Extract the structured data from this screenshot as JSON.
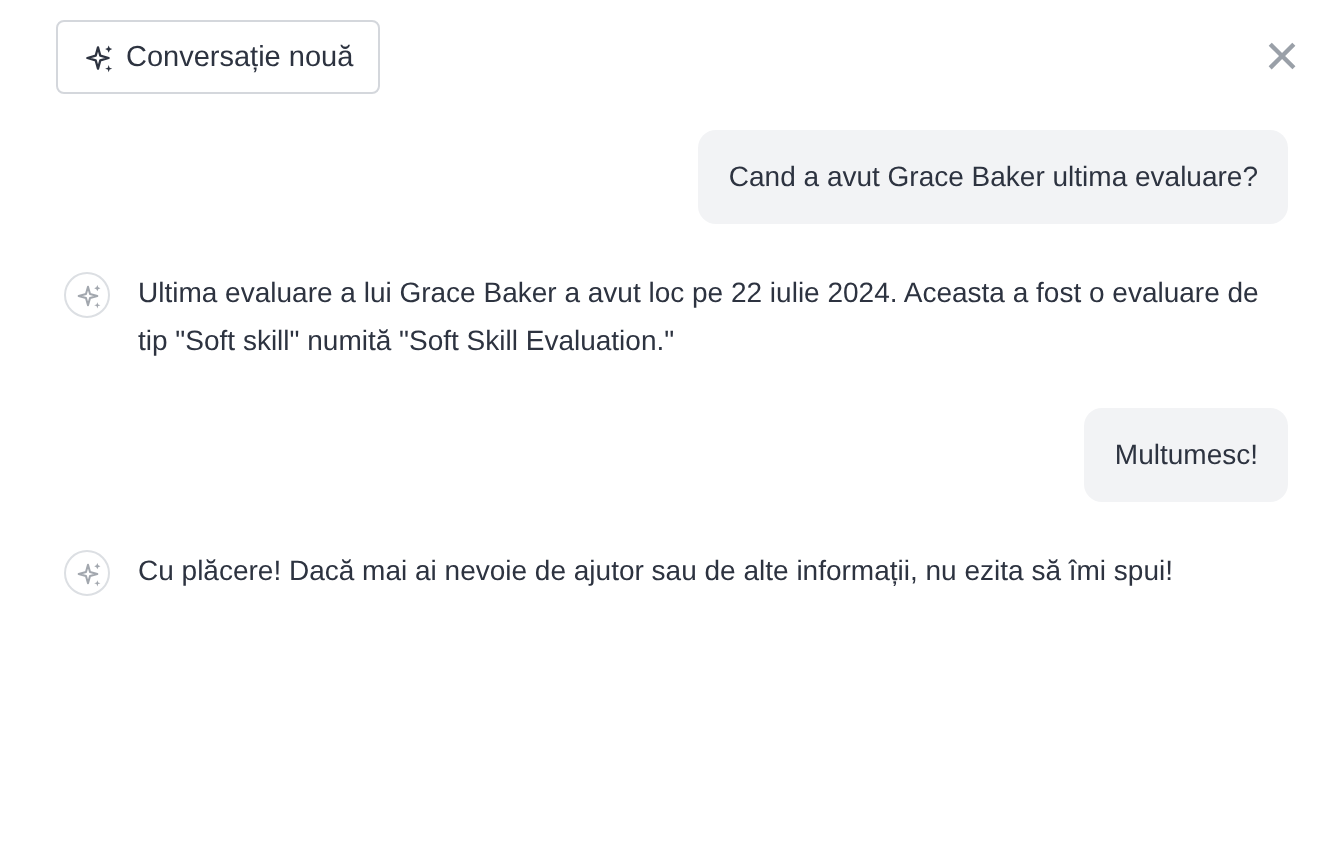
{
  "header": {
    "new_chat_button": "Conversație nouă",
    "close": "×"
  },
  "messages": [
    {
      "kind": "user",
      "text": "Cand a avut Grace Baker ultima evaluare?"
    },
    {
      "kind": "assistant",
      "text": "Ultima evaluare a lui Grace Baker a avut loc pe 22 iulie 2024. Aceasta a fost o evaluare de tip \"Soft skill\" numită \"Soft Skill Evaluation.\""
    },
    {
      "kind": "user",
      "text": "Multumesc!"
    },
    {
      "kind": "assistant",
      "text": "Cu plăcere! Dacă mai ai nevoie de ajutor sau de alte informații, nu ezita să îmi spui!"
    }
  ]
}
